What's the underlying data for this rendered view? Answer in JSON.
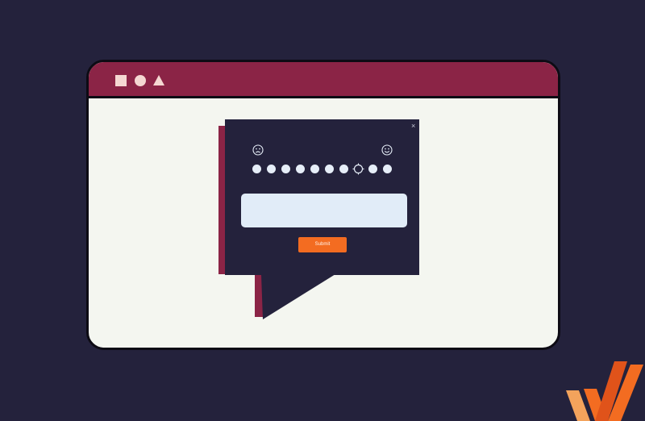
{
  "window": {
    "controls": [
      {
        "icon": "square-icon"
      },
      {
        "icon": "circle-icon"
      },
      {
        "icon": "triangle-icon"
      }
    ]
  },
  "survey": {
    "close_label": "×",
    "low_icon": "sad-face-icon",
    "high_icon": "happy-face-icon",
    "scale_points": 10,
    "selected_point": 8,
    "comment_value": "",
    "submit_label": "Submit"
  },
  "colors": {
    "background": "#24223c",
    "titlebar": "#8b2446",
    "window_body": "#f4f6f0",
    "submit": "#f36c21",
    "comment_box": "#e1ecf8"
  },
  "brand": {
    "logo_icon": "brand-logo-icon"
  }
}
